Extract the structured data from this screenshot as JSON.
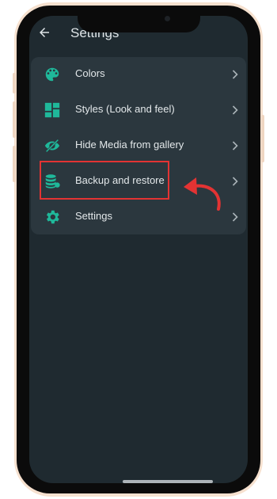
{
  "colors": {
    "accent": "#1fb89a",
    "screen_bg": "#1f2a30",
    "card_bg": "#2b373e",
    "text": "#e3e8ea",
    "annotation": "#e33333"
  },
  "appbar": {
    "back_icon": "arrow-left-icon",
    "title": "Settings"
  },
  "menu": {
    "items": [
      {
        "label": "Colors",
        "icon": "palette-icon"
      },
      {
        "label": "Styles (Look and feel)",
        "icon": "dashboard-layout-icon"
      },
      {
        "label": "Hide Media from gallery",
        "icon": "eye-off-icon"
      },
      {
        "label": "Backup and restore",
        "icon": "database-stack-icon"
      },
      {
        "label": "Settings",
        "icon": "gear-icon"
      }
    ],
    "chevron_icon": "chevron-right-icon",
    "highlighted_item": "Backup and restore"
  }
}
